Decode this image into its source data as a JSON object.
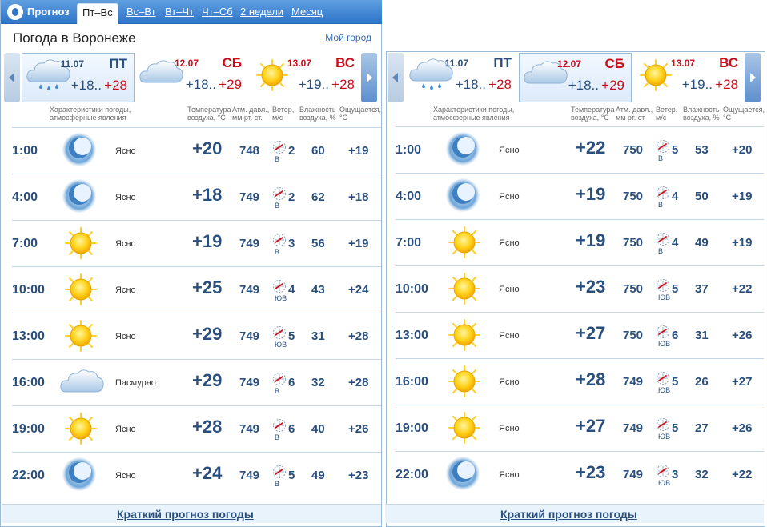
{
  "header": {
    "brand": "Прогноз",
    "tabs": [
      {
        "label": "Пт–Вс",
        "active": true
      },
      {
        "label": "Вс–Вт"
      },
      {
        "label": "Вт–Чт"
      },
      {
        "label": "Чт–Сб"
      },
      {
        "label": "2 недели"
      },
      {
        "label": "Месяц"
      }
    ],
    "city_title": "Погода в Воронеже",
    "my_city": "Мой город"
  },
  "days": [
    {
      "date": "11.07",
      "dow": "ПТ",
      "tmin": "+18..",
      "tmax": "+28",
      "icon": "cloud-rain-icon",
      "weekend": false
    },
    {
      "date": "12.07",
      "dow": "СБ",
      "tmin": "+18..",
      "tmax": "+29",
      "icon": "cloud-icon",
      "weekend": true
    },
    {
      "date": "13.07",
      "dow": "ВС",
      "tmin": "+19..",
      "tmax": "+28",
      "icon": "sun-icon",
      "weekend": true
    }
  ],
  "columns": {
    "cond": "Характеристики погоды,\nатмосферные явления",
    "temp": "Температура\nвоздуха, °С",
    "pres": "Атм. давл.,\nмм рт. ст.",
    "wind": "Ветер,\nм/с",
    "hum": "Влажность\nвоздуха, %",
    "feel": "Ощущается,\n°С"
  },
  "panels": [
    {
      "selected_day": 0,
      "rows": [
        {
          "time": "1:00",
          "icon": "moon-icon",
          "cond": "Ясно",
          "temp": "+20",
          "pres": "748",
          "wspd": "2",
          "wdir": "В",
          "hum": "60",
          "feel": "+19"
        },
        {
          "time": "4:00",
          "icon": "moon-icon",
          "cond": "Ясно",
          "temp": "+18",
          "pres": "749",
          "wspd": "2",
          "wdir": "В",
          "hum": "62",
          "feel": "+18"
        },
        {
          "time": "7:00",
          "icon": "sun-icon",
          "cond": "Ясно",
          "temp": "+19",
          "pres": "749",
          "wspd": "3",
          "wdir": "В",
          "hum": "56",
          "feel": "+19"
        },
        {
          "time": "10:00",
          "icon": "sun-icon",
          "cond": "Ясно",
          "temp": "+25",
          "pres": "749",
          "wspd": "4",
          "wdir": "ЮВ",
          "hum": "43",
          "feel": "+24"
        },
        {
          "time": "13:00",
          "icon": "sun-icon",
          "cond": "Ясно",
          "temp": "+29",
          "pres": "749",
          "wspd": "5",
          "wdir": "ЮВ",
          "hum": "31",
          "feel": "+28"
        },
        {
          "time": "16:00",
          "icon": "cloud-icon",
          "cond": "Пасмурно",
          "temp": "+29",
          "pres": "749",
          "wspd": "6",
          "wdir": "В",
          "hum": "32",
          "feel": "+28"
        },
        {
          "time": "19:00",
          "icon": "sun-icon",
          "cond": "Ясно",
          "temp": "+28",
          "pres": "749",
          "wspd": "6",
          "wdir": "В",
          "hum": "40",
          "feel": "+26"
        },
        {
          "time": "22:00",
          "icon": "moon-icon",
          "cond": "Ясно",
          "temp": "+24",
          "pres": "749",
          "wspd": "5",
          "wdir": "В",
          "hum": "49",
          "feel": "+23"
        }
      ],
      "footer": "Краткий прогноз погоды"
    },
    {
      "selected_day": 1,
      "rows": [
        {
          "time": "1:00",
          "icon": "moon-icon",
          "cond": "Ясно",
          "temp": "+22",
          "pres": "750",
          "wspd": "5",
          "wdir": "В",
          "hum": "53",
          "feel": "+20"
        },
        {
          "time": "4:00",
          "icon": "moon-icon",
          "cond": "Ясно",
          "temp": "+19",
          "pres": "750",
          "wspd": "4",
          "wdir": "В",
          "hum": "50",
          "feel": "+19"
        },
        {
          "time": "7:00",
          "icon": "sun-icon",
          "cond": "Ясно",
          "temp": "+19",
          "pres": "750",
          "wspd": "4",
          "wdir": "В",
          "hum": "49",
          "feel": "+19"
        },
        {
          "time": "10:00",
          "icon": "sun-icon",
          "cond": "Ясно",
          "temp": "+23",
          "pres": "750",
          "wspd": "5",
          "wdir": "ЮВ",
          "hum": "37",
          "feel": "+22"
        },
        {
          "time": "13:00",
          "icon": "sun-icon",
          "cond": "Ясно",
          "temp": "+27",
          "pres": "750",
          "wspd": "6",
          "wdir": "ЮВ",
          "hum": "31",
          "feel": "+26"
        },
        {
          "time": "16:00",
          "icon": "sun-icon",
          "cond": "Ясно",
          "temp": "+28",
          "pres": "749",
          "wspd": "5",
          "wdir": "ЮВ",
          "hum": "26",
          "feel": "+27"
        },
        {
          "time": "19:00",
          "icon": "sun-icon",
          "cond": "Ясно",
          "temp": "+27",
          "pres": "749",
          "wspd": "5",
          "wdir": "ЮВ",
          "hum": "27",
          "feel": "+26"
        },
        {
          "time": "22:00",
          "icon": "moon-icon",
          "cond": "Ясно",
          "temp": "+23",
          "pres": "749",
          "wspd": "3",
          "wdir": "ЮВ",
          "hum": "32",
          "feel": "+22"
        }
      ],
      "footer": "Краткий прогноз погоды"
    }
  ],
  "colors": {
    "accent": "#2f74c9",
    "text": "#2b4f7c",
    "weekend": "#c8101c"
  }
}
